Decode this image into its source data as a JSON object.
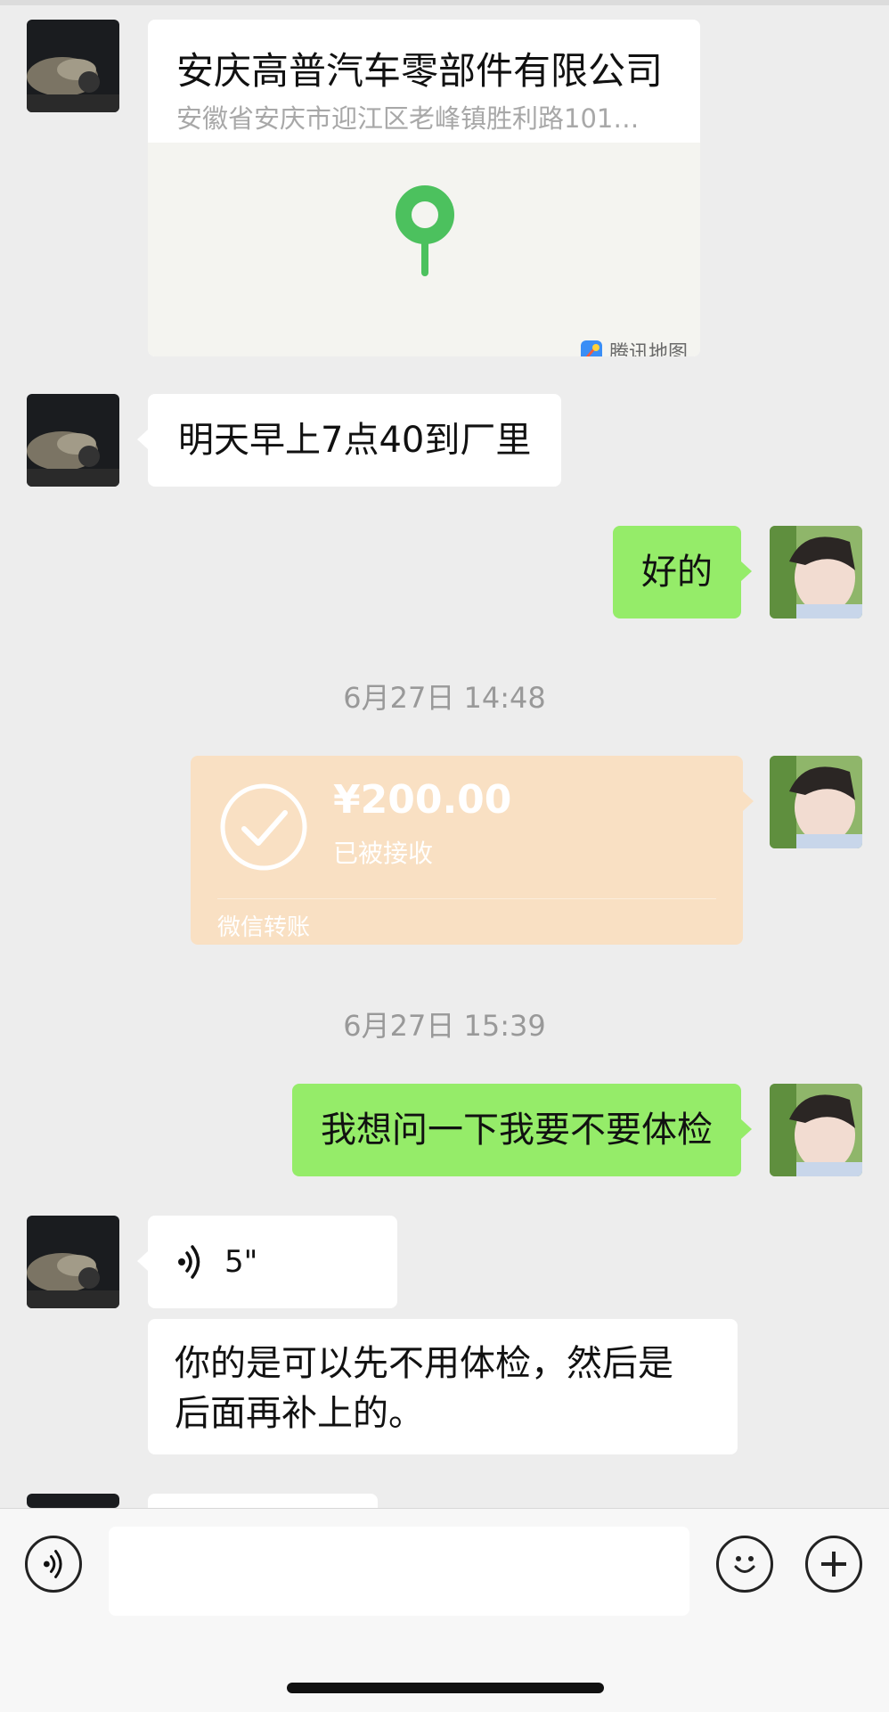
{
  "location": {
    "title": "安庆高普汽车零部件有限公司",
    "address": "安徽省安庆市迎江区老峰镇胜利路101…",
    "map_brand": "腾讯地图"
  },
  "messages": {
    "m1": "明天早上7点40到厂里",
    "m2": "好的",
    "m3": "我想问一下我要不要体检",
    "voice_duration": "5\"",
    "m4_line1": "你的是可以先不用体检，然后是",
    "m4_line2": "后面再补上的。"
  },
  "timestamps": {
    "t1": "6月27日 14:48",
    "t2": "6月27日 15:39"
  },
  "transfer": {
    "amount": "¥200.00",
    "status": "已被接收",
    "label": "微信转账"
  },
  "colors": {
    "my_bubble": "#95ec69",
    "their_bubble": "#ffffff",
    "transfer_card": "#f9e0c3",
    "background": "#ededed",
    "map_pin": "#4cc15e"
  }
}
